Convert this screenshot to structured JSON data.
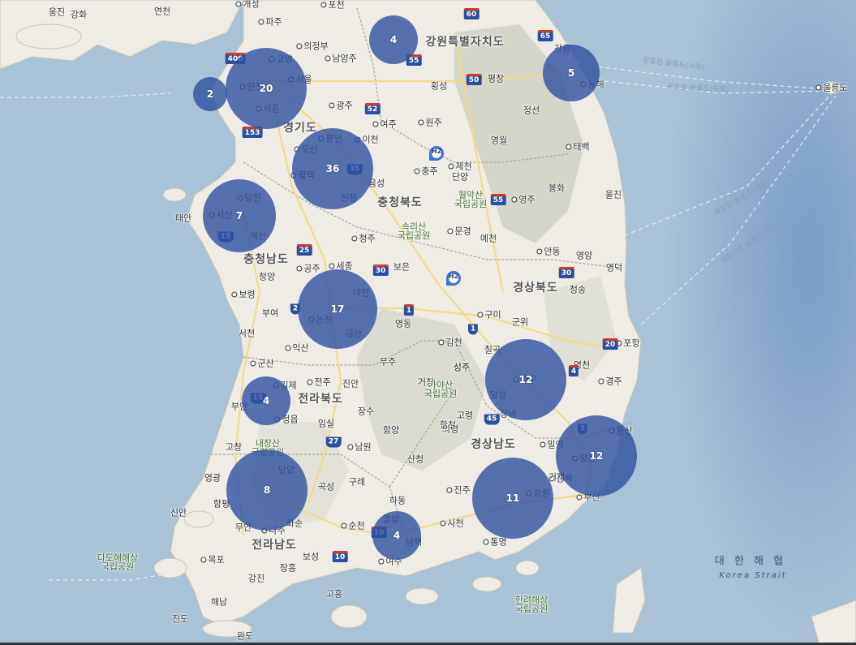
{
  "colors": {
    "sea": "#a9c2d6",
    "land": "#eeece4",
    "cluster_fill": "#3050a0"
  },
  "clusters": [
    {
      "id": "incheon-west",
      "count": "2"
    },
    {
      "id": "seoul",
      "count": "20"
    },
    {
      "id": "chuncheon",
      "count": "4"
    },
    {
      "id": "gangneung",
      "count": "5"
    },
    {
      "id": "suwon-yongin",
      "count": "36"
    },
    {
      "id": "seosan",
      "count": "7"
    },
    {
      "id": "daejeon",
      "count": "17"
    },
    {
      "id": "gunsan-buan",
      "count": "4"
    },
    {
      "id": "daegu",
      "count": "12"
    },
    {
      "id": "ulsan",
      "count": "12"
    },
    {
      "id": "gwangju",
      "count": "8"
    },
    {
      "id": "changwon",
      "count": "11"
    },
    {
      "id": "suncheon",
      "count": "4"
    }
  ],
  "labels": {
    "regions": [
      "강원특별자치도",
      "경기도",
      "충청북도",
      "충청남도",
      "전라북도",
      "경상북도",
      "경상남도",
      "전라남도"
    ],
    "cities": [
      "파주",
      "의정부",
      "남양주",
      "고양",
      "인천",
      "서울",
      "시흥",
      "광주",
      "여주",
      "원주",
      "횡성",
      "평창",
      "강릉",
      "동해",
      "태백",
      "정선",
      "영월",
      "제천",
      "충주",
      "단양",
      "영주",
      "봉화",
      "울진",
      "이천",
      "오산",
      "용인",
      "평택",
      "진천",
      "음성",
      "당진",
      "서산",
      "태안",
      "예산",
      "청주",
      "세종",
      "공주",
      "보은",
      "문경",
      "예천",
      "안동",
      "영덕",
      "청송",
      "보령",
      "청양",
      "부여",
      "논산",
      "금산",
      "영동",
      "대전",
      "구미",
      "군위",
      "상주",
      "김천",
      "칠곡",
      "서천",
      "익산",
      "군산",
      "김제",
      "전주",
      "진안",
      "무주",
      "성주",
      "고령",
      "달성",
      "대구",
      "영천",
      "경주",
      "포항",
      "영양",
      "부안",
      "정읍",
      "임실",
      "장수",
      "거창",
      "합천",
      "창녕",
      "밀양",
      "울산",
      "고창",
      "남원",
      "함양",
      "산청",
      "의령",
      "김해",
      "양산",
      "부산",
      "영광",
      "함평",
      "담양",
      "곡성",
      "구례",
      "진주",
      "하동",
      "창원",
      "신안",
      "나주",
      "화순",
      "순천",
      "광양",
      "사천",
      "남해",
      "통영",
      "거제",
      "목포",
      "무안",
      "보성",
      "강진",
      "장흥",
      "여수",
      "고흥",
      "해남",
      "진도",
      "완도",
      "울릉도",
      "옹진",
      "강화",
      "연천",
      "개성",
      "포천"
    ],
    "parks": [
      "월악산\n국립공원",
      "속리산\n국립공원",
      "가야산\n국립공원",
      "내장산\n국립공원",
      "다도해해상\n국립공원",
      "한려해상\n국립공원"
    ],
    "sea_ko": "대 한 해 협",
    "sea_en": "Korea Strait",
    "routes": [
      "강릉항-울릉도(서쪽)",
      "묵호항-울릉도(동쪽)",
      "후포항-울릉도(서쪽)",
      "포항구항-울릉도(서쪽)"
    ],
    "shields": [
      "60",
      "65",
      "55",
      "50",
      "52",
      "400",
      "153",
      "35",
      "25",
      "30",
      "2",
      "1",
      "20",
      "45",
      "27",
      "15",
      "10",
      "5",
      "4"
    ],
    "h2": "H2"
  }
}
